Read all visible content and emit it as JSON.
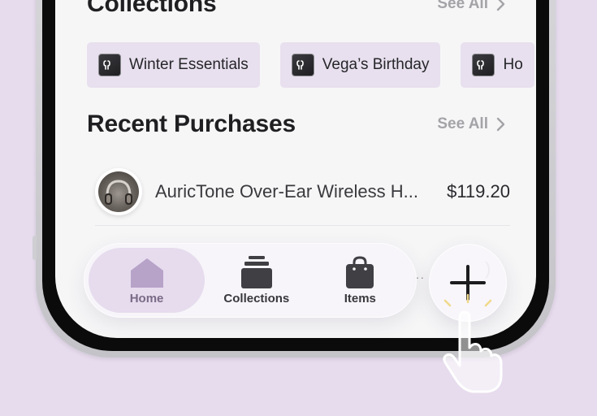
{
  "collections": {
    "title": "Collections",
    "see_all": "See All",
    "items": [
      {
        "label": "Winter Essentials",
        "icon": "tag-icon"
      },
      {
        "label": "Vega’s Birthday",
        "icon": "tag-icon"
      },
      {
        "label": "Ho",
        "icon": "tag-icon"
      }
    ]
  },
  "recent_purchases": {
    "title": "Recent Purchases",
    "see_all": "See All",
    "items": [
      {
        "name": "AuricTone Over-Ear Wireless H...",
        "price": "$119.20",
        "thumbnail": "headphones-thumbnail"
      }
    ],
    "partial_next": {
      "dots": "..",
      "price_fragment": ")"
    }
  },
  "tab_bar": {
    "tabs": [
      {
        "label": "Home",
        "icon": "house-icon",
        "active": true
      },
      {
        "label": "Collections",
        "icon": "stack-icon",
        "active": false
      },
      {
        "label": "Items",
        "icon": "bag-icon",
        "active": false
      }
    ],
    "add_icon": "plus-icon"
  },
  "colors": {
    "background": "#e7dcee",
    "accent": "#b7a2c8",
    "chip_bg": "#e8e0ee",
    "active_tab_bg": "#e6dcee",
    "tap_highlight": "#f0d98a"
  }
}
